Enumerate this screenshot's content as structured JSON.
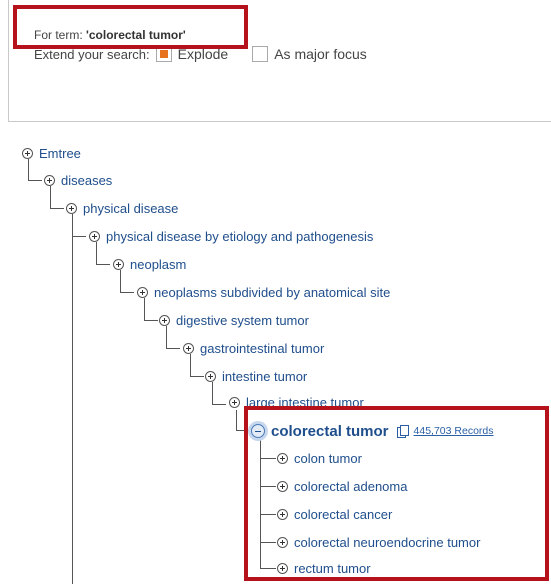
{
  "search": {
    "term_prefix": "For term: ",
    "term_value": "'colorectal tumor'",
    "extend_label": "Extend your search:",
    "explode_label": "Explode",
    "explode_checked": true,
    "major_focus_label": "As major focus",
    "major_focus_checked": false
  },
  "colors": {
    "highlight_border": "#b5121b",
    "checkbox_fill": "#e8731e",
    "link": "#1f4e8c"
  },
  "tree": {
    "ancestors": [
      {
        "label": "Emtree",
        "icon": "plus-circle-icon"
      },
      {
        "label": "diseases",
        "icon": "plus-circle-icon"
      },
      {
        "label": "physical disease",
        "icon": "plus-circle-icon"
      },
      {
        "label": "physical disease by etiology and pathogenesis",
        "icon": "plus-circle-icon"
      },
      {
        "label": "neoplasm",
        "icon": "plus-circle-icon"
      },
      {
        "label": "neoplasms subdivided by anatomical site",
        "icon": "plus-circle-icon"
      },
      {
        "label": "digestive system tumor",
        "icon": "plus-circle-icon"
      },
      {
        "label": "gastrointestinal tumor",
        "icon": "plus-circle-icon"
      },
      {
        "label": "intestine tumor",
        "icon": "plus-circle-icon"
      },
      {
        "label": "large intestine tumor",
        "icon": "plus-circle-icon"
      }
    ],
    "current": {
      "label": "colorectal tumor",
      "icon": "minus-circle-icon",
      "records": "445,703 Records"
    },
    "children": [
      {
        "label": "colon tumor"
      },
      {
        "label": "colorectal adenoma"
      },
      {
        "label": "colorectal cancer"
      },
      {
        "label": "colorectal neuroendocrine tumor"
      },
      {
        "label": "rectum tumor"
      }
    ]
  }
}
